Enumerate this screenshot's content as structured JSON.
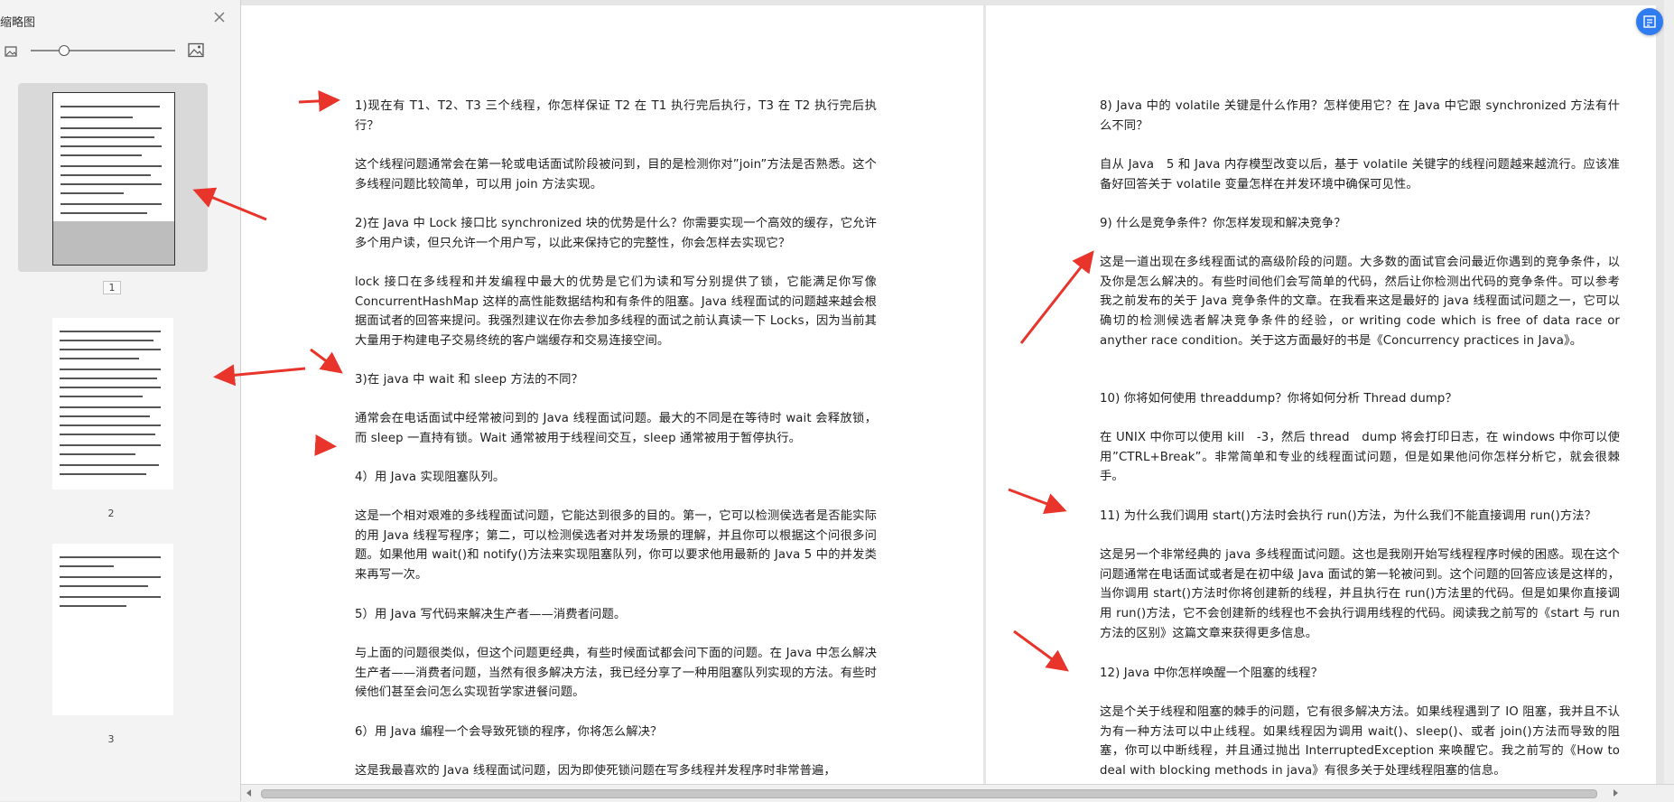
{
  "sidebar": {
    "title": "缩略图",
    "thumbnails": [
      {
        "label": "1"
      },
      {
        "label": "2"
      },
      {
        "label": "3"
      }
    ]
  },
  "colors": {
    "arrow": "#e8342a",
    "accent_button": "#2f7bf0"
  },
  "icons": {
    "close": "close-icon",
    "zoom_out": "image-small-icon",
    "zoom_in": "image-large-icon",
    "float": "document-icon"
  },
  "left_page": {
    "paragraphs": [
      "1)现在有 T1、T2、T3 三个线程，你怎样保证 T2 在 T1 执行完后执行，T3 在 T2 执行完后执行？",
      "这个线程问题通常会在第一轮或电话面试阶段被问到，目的是检测你对”join”方法是否熟悉。这个多线程问题比较简单，可以用 join 方法实现。",
      "2)在 Java 中 Lock 接口比 synchronized 块的优势是什么？你需要实现一个高效的缓存，它允许多个用户读，但只允许一个用户写，以此来保持它的完整性，你会怎样去实现它？",
      "lock 接口在多线程和并发编程中最大的优势是它们为读和写分别提供了锁，它能满足你写像 ConcurrentHashMap 这样的高性能数据结构和有条件的阻塞。Java 线程面试的问题越来越会根据面试者的回答来提问。我强烈建议在你去参加多线程的面试之前认真读一下 Locks，因为当前其大量用于构建电子交易终统的客户端缓存和交易连接空间。",
      "3)在 java 中 wait 和 sleep 方法的不同？",
      "通常会在电话面试中经常被问到的 Java 线程面试问题。最大的不同是在等待时 wait 会释放锁，而 sleep 一直持有锁。Wait 通常被用于线程间交互，sleep 通常被用于暂停执行。",
      "4）用 Java 实现阻塞队列。",
      "这是一个相对艰难的多线程面试问题，它能达到很多的目的。第一，它可以检测侯选者是否能实际的用 Java 线程写程序；第二，可以检测侯选者对并发场景的理解，并且你可以根据这个问很多问题。如果他用 wait()和 notify()方法来实现阻塞队列，你可以要求他用最新的 Java 5 中的并发类来再写一次。",
      "5）用 Java 写代码来解决生产者——消费者问题。",
      "与上面的问题很类似，但这个问题更经典，有些时候面试都会问下面的问题。在 Java 中怎么解决生产者——消费者问题，当然有很多解决方法，我已经分享了一种用阻塞队列实现的方法。有些时候他们甚至会问怎么实现哲学家进餐问题。",
      "6）用 Java 编程一个会导致死锁的程序，你将怎么解决？",
      "这是我最喜欢的 Java 线程面试问题，因为即使死锁问题在写多线程并发程序时非常普遍，"
    ]
  },
  "right_page": {
    "paragraphs": [
      "8) Java 中的 volatile 关键是什么作用？怎样使用它？在 Java 中它跟 synchronized 方法有什么不同？",
      "自从 Java　5 和 Java 内存模型改变以后，基于 volatile 关键字的线程问题越来越流行。应该准备好回答关于 volatile 变量怎样在并发环境中确保可见性。",
      "9) 什么是竞争条件？你怎样发现和解决竞争？",
      "这是一道出现在多线程面试的高级阶段的问题。大多数的面试官会问最近你遇到的竞争条件，以及你是怎么解决的。有些时间他们会写简单的代码，然后让你检测出代码的竞争条件。可以参考我之前发布的关于 Java 竞争条件的文章。在我看来这是最好的 java 线程面试问题之一，它可以确切的检测候选者解决竞争条件的经验，or writing code which is free of data race or anyther race condition。关于这方面最好的书是《Concurrency practices in Java》。",
      "10) 你将如何使用 threaddump？你将如何分析 Thread dump？",
      "在 UNIX 中你可以使用 kill　-3，然后 thread　dump 将会打印日志，在 windows 中你可以使用”CTRL+Break”。非常简单和专业的线程面试问题，但是如果他问你怎样分析它，就会很棘手。",
      "11) 为什么我们调用 start()方法时会执行 run()方法，为什么我们不能直接调用 run()方法？",
      "这是另一个非常经典的 java 多线程面试问题。这也是我刚开始写线程程序时候的困惑。现在这个问题通常在电话面试或者是在初中级 Java 面试的第一轮被问到。这个问题的回答应该是这样的，当你调用 start()方法时你将创建新的线程，并且执行在 run()方法里的代码。但是如果你直接调用 run()方法，它不会创建新的线程也不会执行调用线程的代码。阅读我之前写的《start 与 run 方法的区别》这篇文章来获得更多信息。",
      "12) Java 中你怎样唤醒一个阻塞的线程？",
      "这是个关于线程和阻塞的棘手的问题，它有很多解决方法。如果线程遇到了 IO 阻塞，我并且不认为有一种方法可以中止线程。如果线程因为调用 wait()、sleep()、或者 join()方法而导致的阻塞，你可以中断线程，并且通过抛出 InterruptedException 来唤醒它。我之前写的《How to deal with blocking methods in java》有很多关于处理线程阻塞的信息。"
    ]
  }
}
